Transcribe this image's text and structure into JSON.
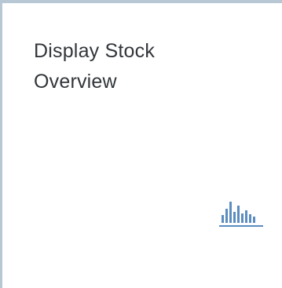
{
  "tile": {
    "title": "Display Stock Overview",
    "icon": "bar-chart-icon",
    "border_color": "#b8c7d4",
    "icon_color": "#5b8dc0"
  }
}
